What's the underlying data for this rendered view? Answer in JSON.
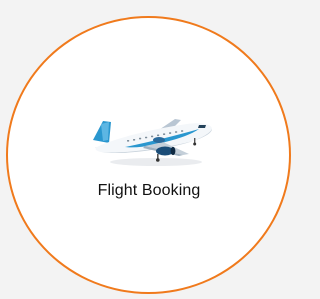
{
  "tile": {
    "label": "Flight Booking",
    "icon": "airplane-icon",
    "border_color": "#f07a1c",
    "background_color": "#ffffff"
  },
  "page": {
    "background_color": "#f3f3f3"
  }
}
